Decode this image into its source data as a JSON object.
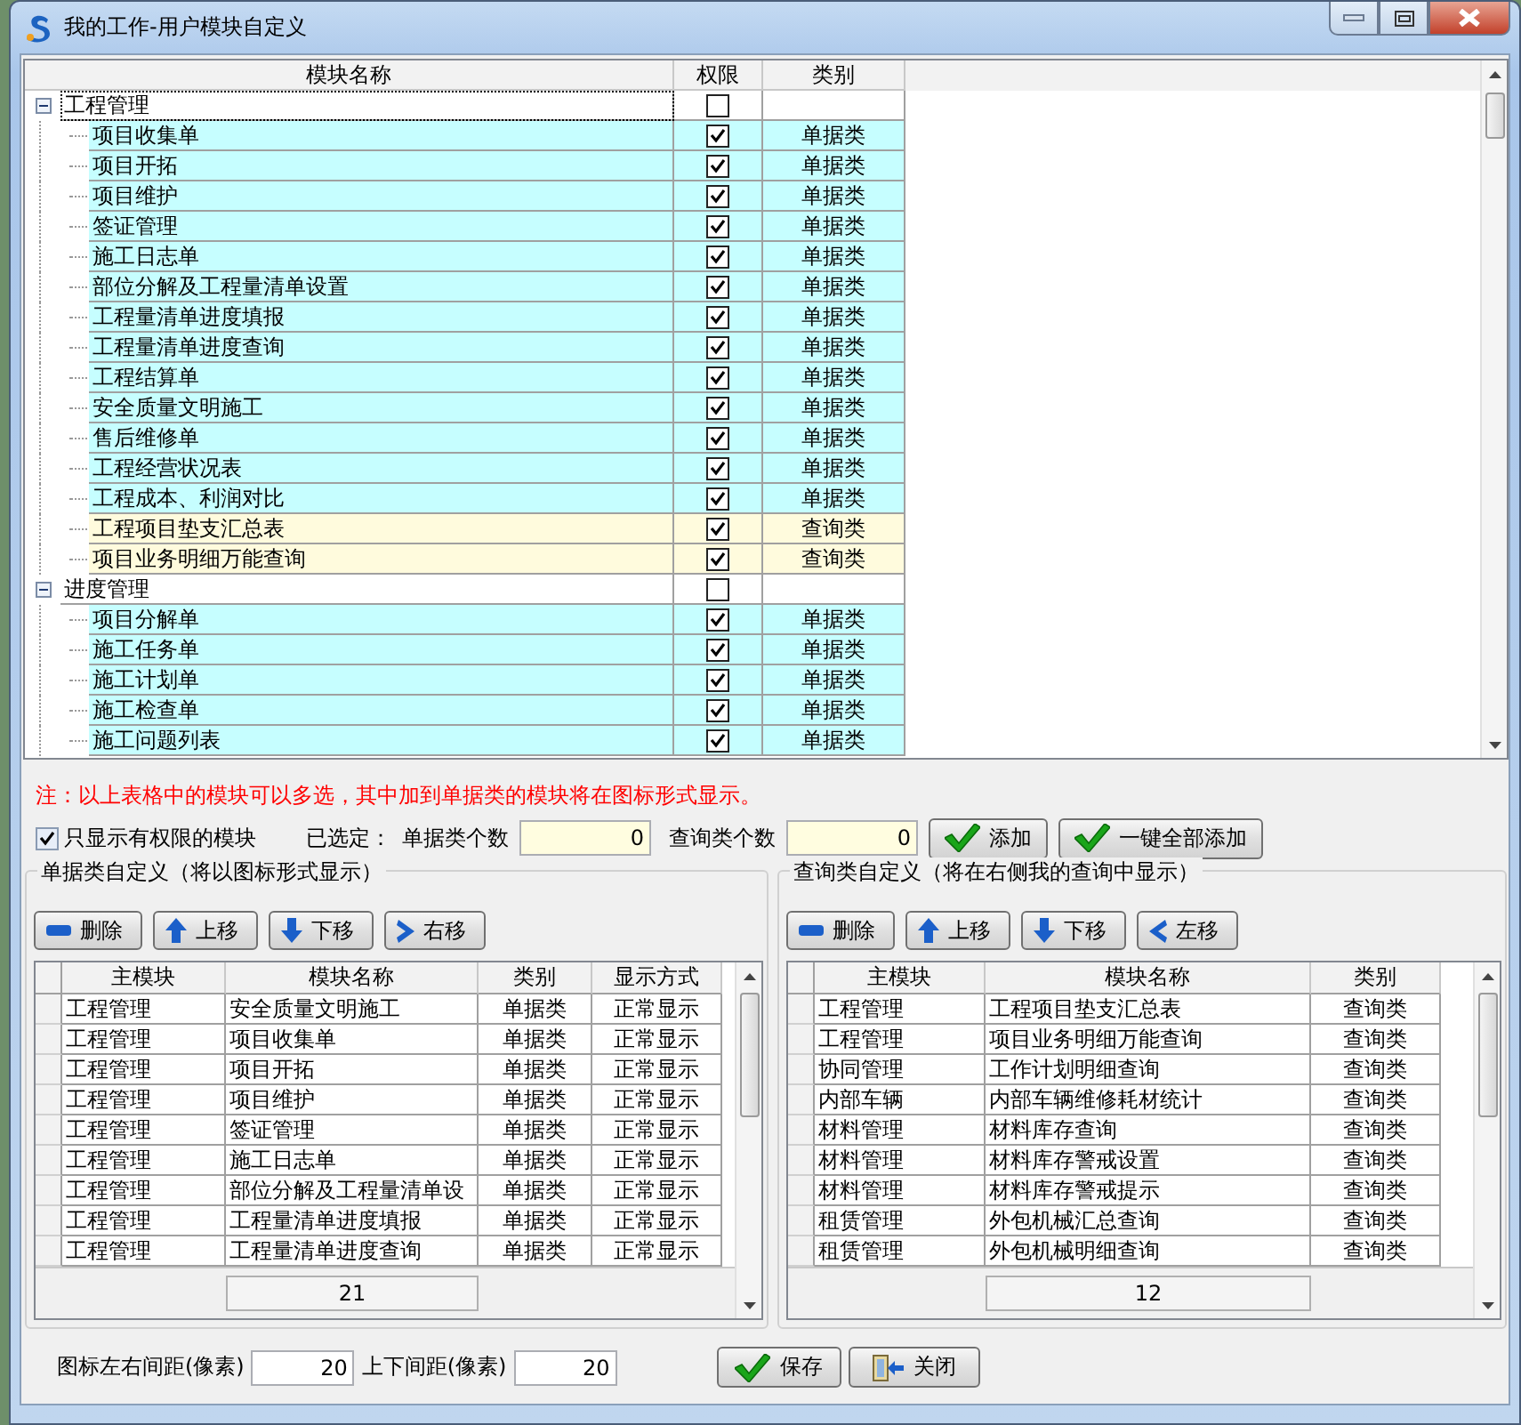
{
  "window": {
    "title": "我的工作-用户模块自定义"
  },
  "module_tree": {
    "columns": [
      "模块名称",
      "权限",
      "类别"
    ],
    "groups": [
      {
        "name": "工程管理",
        "expanded": true,
        "checked": false,
        "selected": true,
        "children": [
          {
            "name": "项目收集单",
            "checked": true,
            "category": "单据类",
            "color": "#c6feff",
            "selected": false
          },
          {
            "name": "项目开拓",
            "checked": true,
            "category": "单据类",
            "color": "#c6feff",
            "selected": false
          },
          {
            "name": "项目维护",
            "checked": true,
            "category": "单据类",
            "color": "#c6feff",
            "selected": false
          },
          {
            "name": "签证管理",
            "checked": true,
            "category": "单据类",
            "color": "#c6feff",
            "selected": false
          },
          {
            "name": "施工日志单",
            "checked": true,
            "category": "单据类",
            "color": "#c6feff",
            "selected": false
          },
          {
            "name": "部位分解及工程量清单设置",
            "checked": true,
            "category": "单据类",
            "color": "#c6feff",
            "selected": false
          },
          {
            "name": "工程量清单进度填报",
            "checked": true,
            "category": "单据类",
            "color": "#c6feff",
            "selected": false
          },
          {
            "name": "工程量清单进度查询",
            "checked": true,
            "category": "单据类",
            "color": "#c6feff",
            "selected": false
          },
          {
            "name": "工程结算单",
            "checked": true,
            "category": "单据类",
            "color": "#c6feff",
            "selected": false
          },
          {
            "name": "安全质量文明施工",
            "checked": true,
            "category": "单据类",
            "color": "#c6feff",
            "selected": false
          },
          {
            "name": "售后维修单",
            "checked": true,
            "category": "单据类",
            "color": "#c6feff",
            "selected": false
          },
          {
            "name": "工程经营状况表",
            "checked": true,
            "category": "单据类",
            "color": "#c6feff",
            "selected": false
          },
          {
            "name": "工程成本、利润对比",
            "checked": true,
            "category": "单据类",
            "color": "#c6feff",
            "selected": false
          },
          {
            "name": "工程项目垫支汇总表",
            "checked": true,
            "category": "查询类",
            "color": "#fffbdd",
            "selected": false
          },
          {
            "name": "项目业务明细万能查询",
            "checked": true,
            "category": "查询类",
            "color": "#fffbdd",
            "selected": false
          }
        ]
      },
      {
        "name": "进度管理",
        "expanded": true,
        "checked": false,
        "selected": false,
        "children": [
          {
            "name": "项目分解单",
            "checked": true,
            "category": "单据类",
            "color": "#c6feff",
            "selected": false
          },
          {
            "name": "施工任务单",
            "checked": true,
            "category": "单据类",
            "color": "#c6feff",
            "selected": false
          },
          {
            "name": "施工计划单",
            "checked": true,
            "category": "单据类",
            "color": "#c6feff",
            "selected": false
          },
          {
            "name": "施工检查单",
            "checked": true,
            "category": "单据类",
            "color": "#c6feff",
            "selected": false
          },
          {
            "name": "施工问题列表",
            "checked": true,
            "category": "单据类",
            "color": "#c6feff",
            "selected": false
          }
        ]
      }
    ]
  },
  "note": "注：以上表格中的模块可以多选，其中加到单据类的模块将在图标形式显示。",
  "filter": {
    "label": "只显示有权限的模块",
    "checked": true
  },
  "selection": {
    "label": "已选定：",
    "bill_count_label": "单据类个数",
    "bill_count": "0",
    "query_count_label": "查询类个数",
    "query_count": "0"
  },
  "actions": [
    {
      "label": "添加",
      "kind": "check"
    },
    {
      "label": "一键全部添加",
      "kind": "check"
    }
  ],
  "panels": [
    {
      "title": "单据类自定义（将以图标形式显示）",
      "buttons": [
        {
          "label": "删除",
          "kind": "remove"
        },
        {
          "label": "上移",
          "kind": "up"
        },
        {
          "label": "下移",
          "kind": "down"
        },
        {
          "label": "右移",
          "kind": "right"
        }
      ],
      "columns": [
        "主模块",
        "模块名称",
        "类别",
        "显示方式"
      ],
      "rows": [
        [
          "工程管理",
          "安全质量文明施工",
          "单据类",
          "正常显示"
        ],
        [
          "工程管理",
          "项目收集单",
          "单据类",
          "正常显示"
        ],
        [
          "工程管理",
          "项目开拓",
          "单据类",
          "正常显示"
        ],
        [
          "工程管理",
          "项目维护",
          "单据类",
          "正常显示"
        ],
        [
          "工程管理",
          "签证管理",
          "单据类",
          "正常显示"
        ],
        [
          "工程管理",
          "施工日志单",
          "单据类",
          "正常显示"
        ],
        [
          "工程管理",
          "部位分解及工程量清单设",
          "单据类",
          "正常显示"
        ],
        [
          "工程管理",
          "工程量清单进度填报",
          "单据类",
          "正常显示"
        ],
        [
          "工程管理",
          "工程量清单进度查询",
          "单据类",
          "正常显示"
        ]
      ],
      "total": "21"
    },
    {
      "title": "查询类自定义（将在右侧我的查询中显示）",
      "buttons": [
        {
          "label": "删除",
          "kind": "remove"
        },
        {
          "label": "上移",
          "kind": "up"
        },
        {
          "label": "下移",
          "kind": "down"
        },
        {
          "label": "左移",
          "kind": "left"
        }
      ],
      "columns": [
        "主模块",
        "模块名称",
        "类别"
      ],
      "rows": [
        [
          "工程管理",
          "工程项目垫支汇总表",
          "查询类"
        ],
        [
          "工程管理",
          "项目业务明细万能查询",
          "查询类"
        ],
        [
          "协同管理",
          "工作计划明细查询",
          "查询类"
        ],
        [
          "内部车辆",
          "内部车辆维修耗材统计",
          "查询类"
        ],
        [
          "材料管理",
          "材料库存查询",
          "查询类"
        ],
        [
          "材料管理",
          "材料库存警戒设置",
          "查询类"
        ],
        [
          "材料管理",
          "材料库存警戒提示",
          "查询类"
        ],
        [
          "租赁管理",
          "外包机械汇总查询",
          "查询类"
        ],
        [
          "租赁管理",
          "外包机械明细查询",
          "查询类"
        ]
      ],
      "total": "12"
    }
  ],
  "spacing": {
    "horizontal_label": "图标左右间距(像素)",
    "horizontal": "20",
    "vertical_label": "上下间距(像素)",
    "vertical": "20"
  },
  "footer_buttons": [
    {
      "label": "保存",
      "kind": "check"
    },
    {
      "label": "关闭",
      "kind": "exit"
    }
  ]
}
